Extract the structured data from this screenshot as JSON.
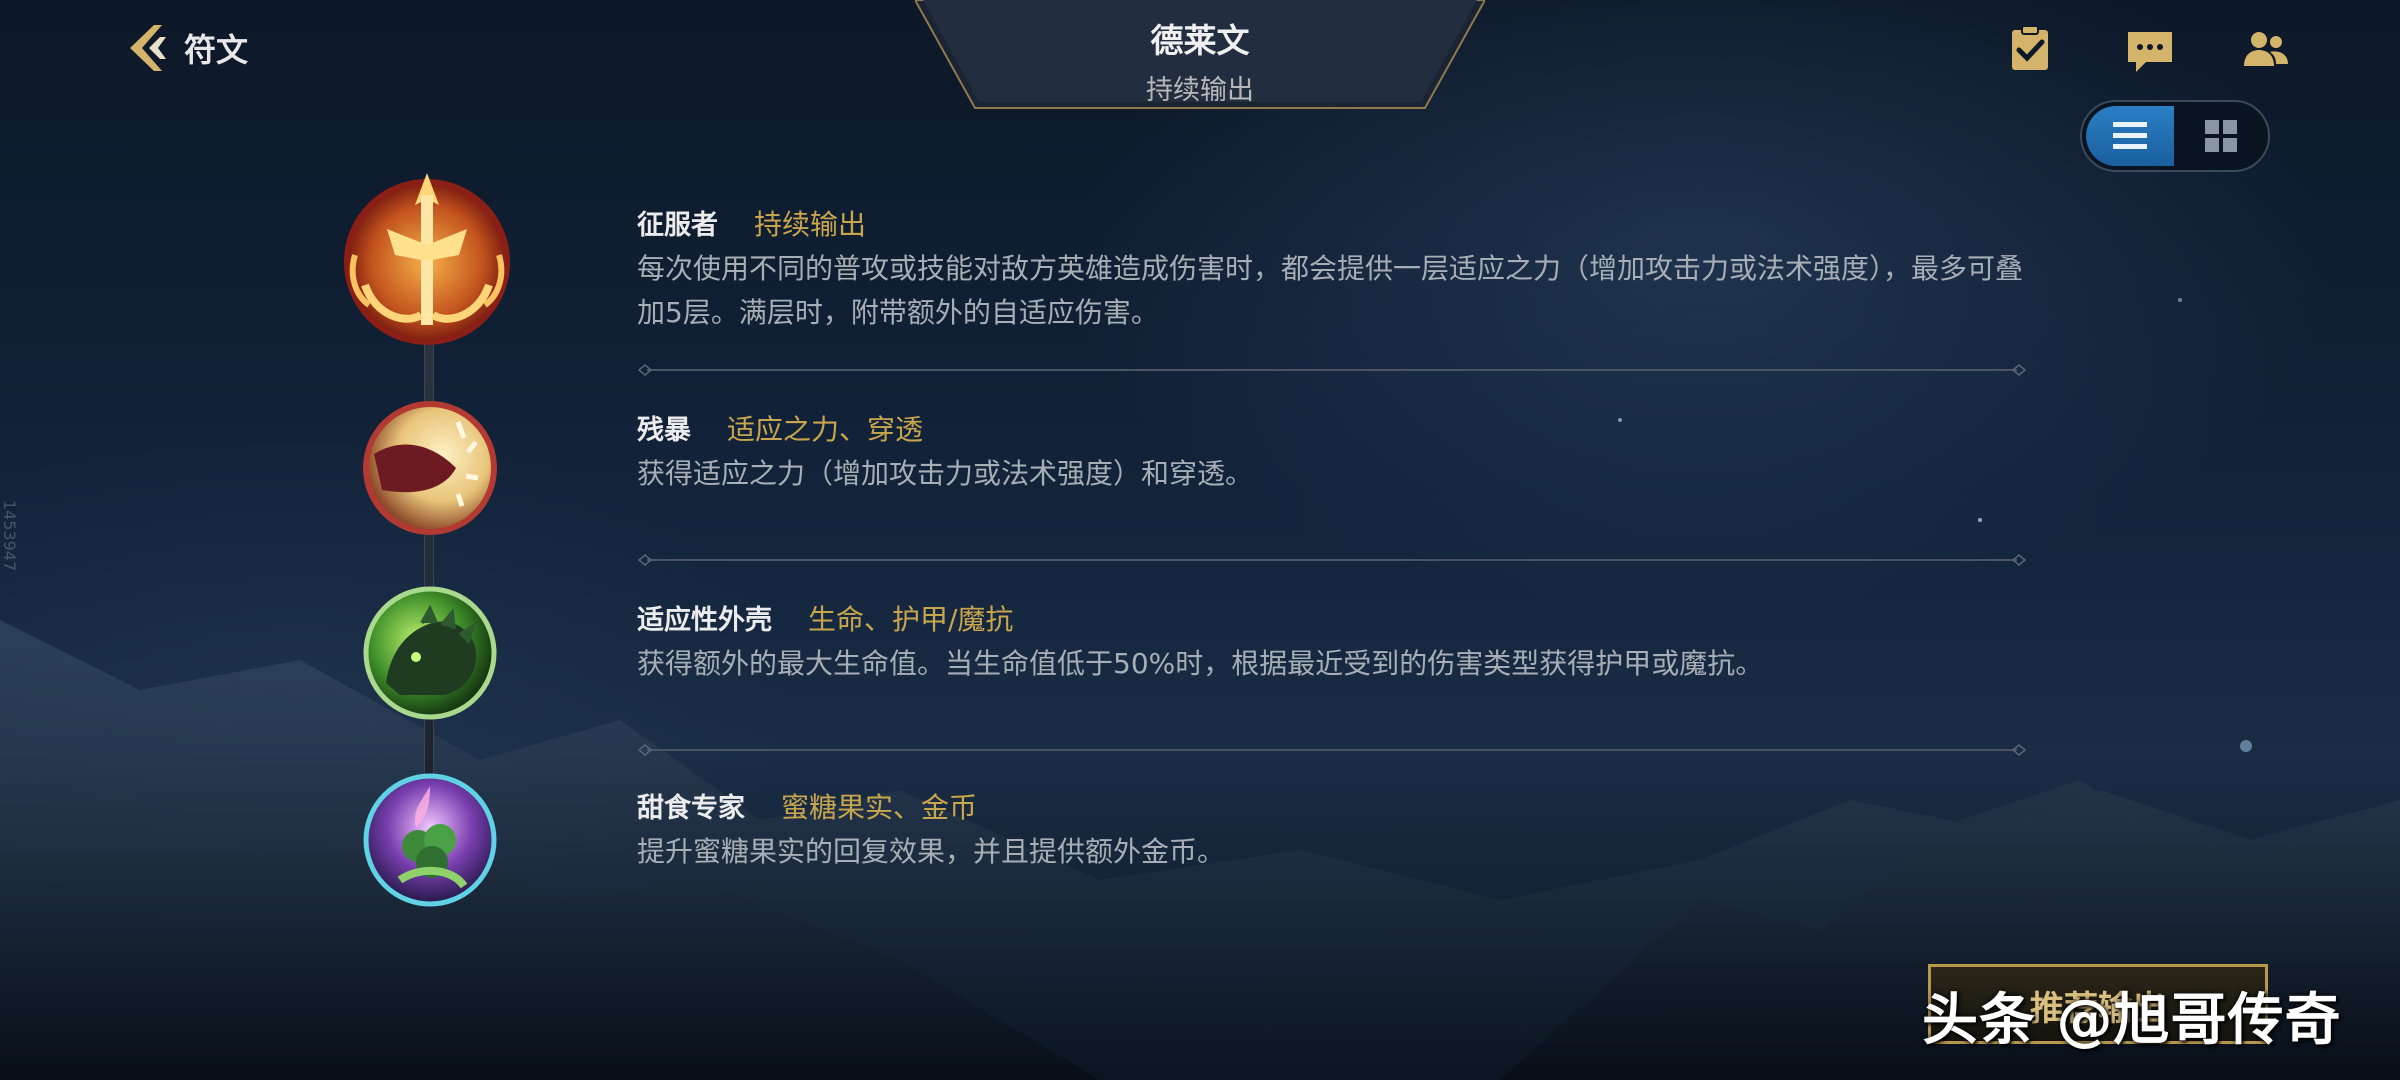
{
  "header": {
    "back_label": "符文",
    "champion_name": "德莱文",
    "subtitle": "持续输出"
  },
  "icons": {
    "back": "back-arrow-icon",
    "tasks": "clipboard-check-icon",
    "chat": "chat-bubble-icon",
    "friends": "friends-icon",
    "list_view": "list-view-icon",
    "grid_view": "grid-view-icon"
  },
  "view_toggle": {
    "selected": "list"
  },
  "runes": [
    {
      "name": "征服者",
      "tag": "持续输出",
      "description": "每次使用不同的普攻或技能对敌方英雄造成伤害时，都会提供一层适应之力（增加攻击力或法术强度），最多可叠加5层。满层时，附带额外的自适应伤害。",
      "icon": "conqueror-icon",
      "border_color": "#c0392b"
    },
    {
      "name": "残暴",
      "tag": "适应之力、穿透",
      "description": "获得适应之力（增加攻击力或法术强度）和穿透。",
      "icon": "brutal-icon",
      "border_color": "#c0392b"
    },
    {
      "name": "适应性外壳",
      "tag": "生命、护甲/魔抗",
      "description": "获得额外的最大生命值。当生命值低于50%时，根据最近受到的伤害类型获得护甲或魔抗。",
      "icon": "adaptive-shell-icon",
      "border_color": "#8fcf5c"
    },
    {
      "name": "甜食专家",
      "tag": "蜜糖果实、金币",
      "description": "提升蜜糖果实的回复效果，并且提供额外金币。",
      "icon": "sweet-tooth-icon",
      "border_color": "#4fc7d9"
    }
  ],
  "bottom_button": {
    "label": "推荐输出"
  },
  "watermark": "头条 @旭哥传奇",
  "side_code": "1453947",
  "colors": {
    "tag_gold": "#c9a64e",
    "accent_blue": "#2a7fc4",
    "gold_border": "#b8974f"
  }
}
